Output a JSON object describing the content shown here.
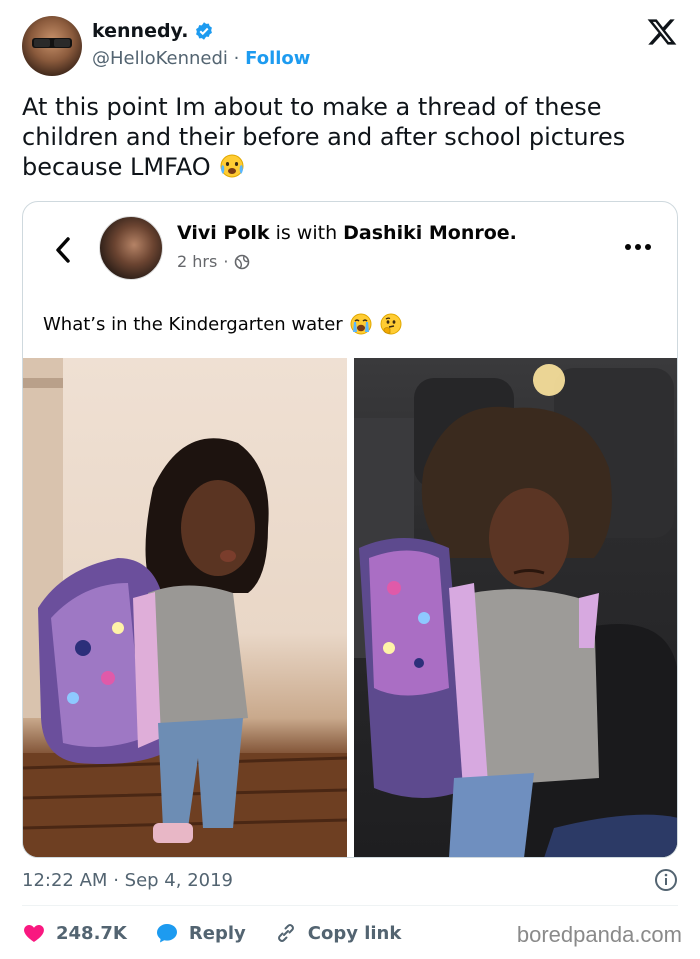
{
  "author": {
    "display_name": "kennedy.",
    "handle": "@HelloKennedi",
    "separator": "·",
    "follow_label": "Follow"
  },
  "tweet": {
    "text": "At this point Im about to make a thread of these children and their before and after school pictures because LMFAO",
    "emoji": "crying-face"
  },
  "embed": {
    "poster_name": "Vivi Polk",
    "with_text": "is with",
    "tagged_name": "Dashiki Monroe.",
    "time_ago": "2 hrs",
    "meta_separator": "·",
    "caption": "What’s in the Kindergarten water",
    "caption_emojis": [
      "loudly-crying-face",
      "thinking-face"
    ]
  },
  "footer": {
    "time": "12:22 AM",
    "separator": "·",
    "date": "Sep 4, 2019",
    "like_count": "248.7K",
    "reply_label": "Reply",
    "copy_link_label": "Copy link",
    "watermark": "boredpanda.com"
  },
  "colors": {
    "link_blue": "#1d9bf0",
    "like_red": "#f91880",
    "secondary_text": "#536471"
  }
}
